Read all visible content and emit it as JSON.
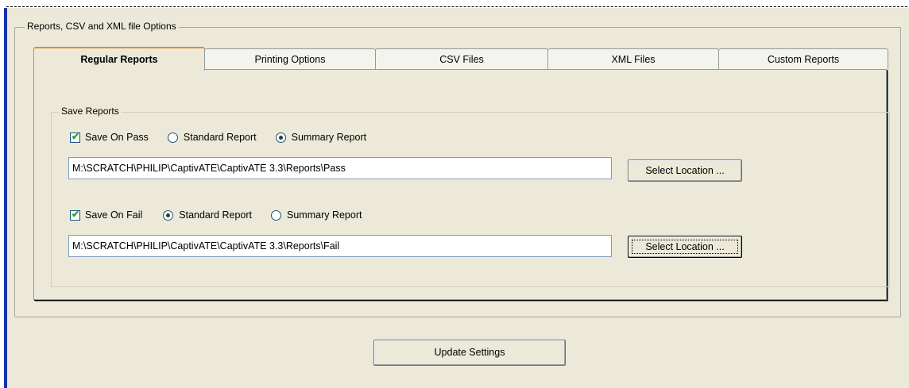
{
  "group": {
    "title": "Reports, CSV and XML file Options"
  },
  "tabs": [
    {
      "label": "Regular Reports",
      "active": true
    },
    {
      "label": "Printing Options",
      "active": false
    },
    {
      "label": "CSV Files",
      "active": false
    },
    {
      "label": "XML Files",
      "active": false
    },
    {
      "label": "Custom Reports",
      "active": false
    }
  ],
  "save_reports": {
    "title": "Save Reports",
    "pass": {
      "checkbox_label": "Save On Pass",
      "checked": true,
      "standard_label": "Standard Report",
      "summary_label": "Summary Report",
      "selected": "summary",
      "path": "M:\\SCRATCH\\PHILIP\\CaptivATE\\CaptivATE 3.3\\Reports\\Pass",
      "select_button": "Select Location ..."
    },
    "fail": {
      "checkbox_label": "Save On Fail",
      "checked": true,
      "standard_label": "Standard Report",
      "summary_label": "Summary Report",
      "selected": "standard",
      "path": "M:\\SCRATCH\\PHILIP\\CaptivATE\\CaptivATE 3.3\\Reports\\Fail",
      "select_button": "Select Location ..."
    }
  },
  "update_button": "Update Settings",
  "colors": {
    "dialog_bg": "#ece9d8",
    "active_tab_accent": "#e68b2c",
    "window_edge": "#1434a8"
  }
}
